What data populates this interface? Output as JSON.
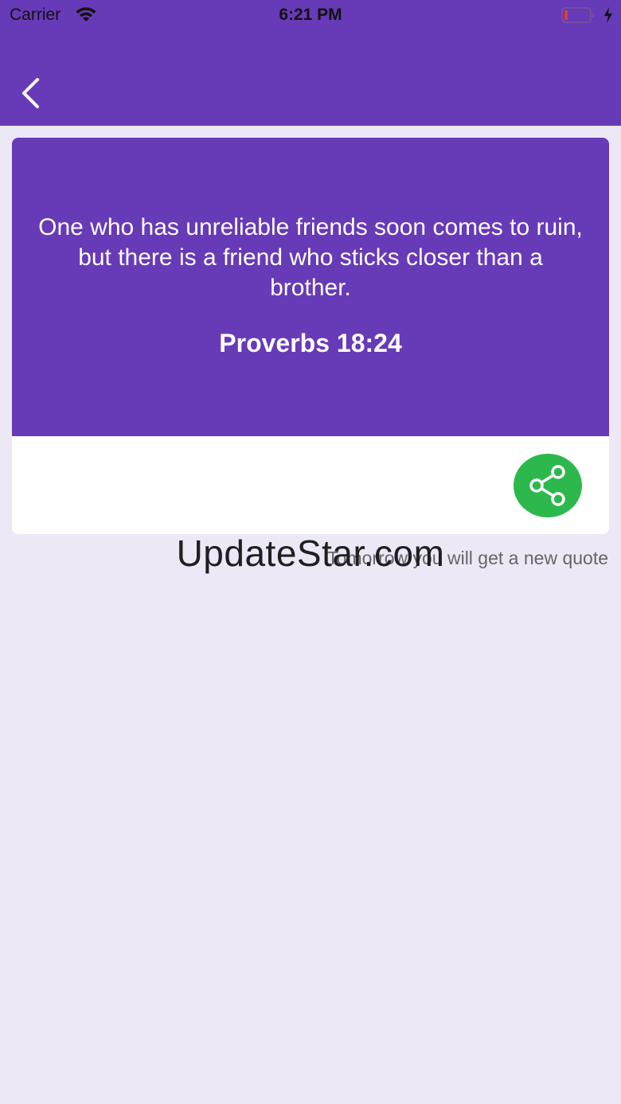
{
  "status_bar": {
    "carrier": "Carrier",
    "time": "6:21 PM",
    "battery_color": "#E53935"
  },
  "nav": {
    "back_icon": "chevron-left-icon"
  },
  "quote": {
    "text": "One who has unreliable friends soon comes to ruin, but there is a friend who sticks closer than a brother.",
    "reference": "Proverbs 18:24"
  },
  "actions": {
    "share_icon": "share-icon",
    "share_color": "#2DB84D"
  },
  "footer": {
    "note": "Tomorrow you will get a new quote"
  },
  "watermark": {
    "text": "UpdateStar.com"
  },
  "colors": {
    "primary": "#673AB7",
    "background": "#ECE8F6"
  }
}
